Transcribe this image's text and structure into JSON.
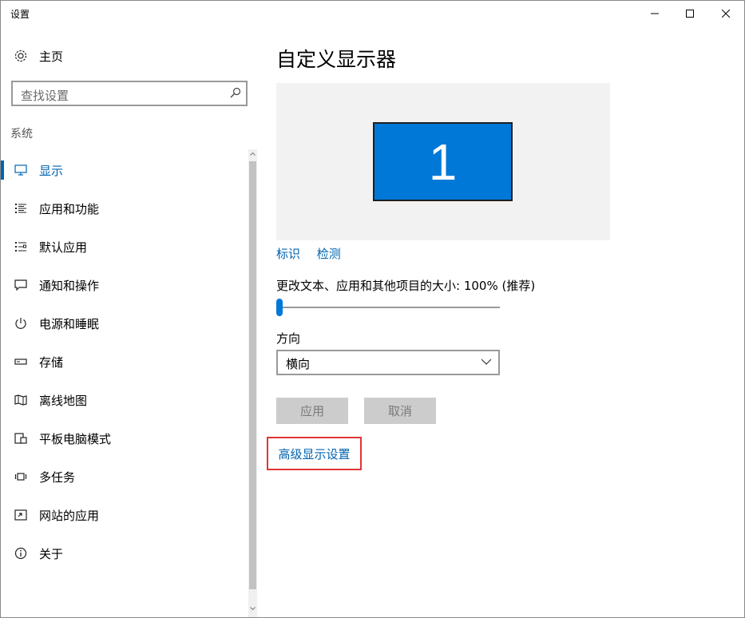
{
  "window": {
    "title": "设置"
  },
  "sidebar": {
    "home_label": "主页",
    "search_placeholder": "查找设置",
    "section_title": "系统",
    "items": [
      {
        "label": "显示",
        "icon": "monitor-icon",
        "active": true
      },
      {
        "label": "应用和功能",
        "icon": "apps-list-icon"
      },
      {
        "label": "默认应用",
        "icon": "default-apps-icon"
      },
      {
        "label": "通知和操作",
        "icon": "notification-icon"
      },
      {
        "label": "电源和睡眠",
        "icon": "power-icon"
      },
      {
        "label": "存储",
        "icon": "storage-icon"
      },
      {
        "label": "离线地图",
        "icon": "map-icon"
      },
      {
        "label": "平板电脑模式",
        "icon": "tablet-mode-icon"
      },
      {
        "label": "多任务",
        "icon": "multitask-icon"
      },
      {
        "label": "网站的应用",
        "icon": "web-apps-icon"
      },
      {
        "label": "关于",
        "icon": "info-icon"
      }
    ]
  },
  "main": {
    "title": "自定义显示器",
    "monitor_number": "1",
    "identify_link": "标识",
    "detect_link": "检测",
    "scale_label": "更改文本、应用和其他项目的大小: 100% (推荐)",
    "scale_value_percent": 0,
    "orientation_label": "方向",
    "orientation_value": "横向",
    "apply_button": "应用",
    "cancel_button": "取消",
    "advanced_link": "高级显示设置"
  },
  "colors": {
    "accent": "#0063b1",
    "monitor_fill": "#0078d7",
    "highlight_border": "#e03535",
    "disabled_button": "#cccccc"
  }
}
